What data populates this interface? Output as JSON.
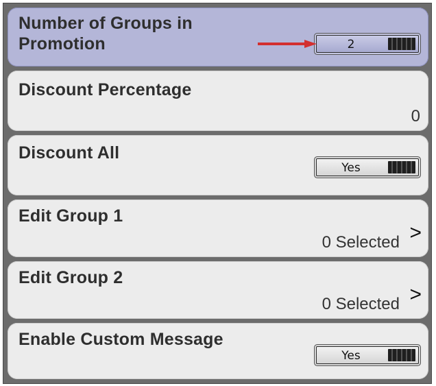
{
  "rows": [
    {
      "label": "Number of Groups in\nPromotion",
      "control": "toggle",
      "value": "2"
    },
    {
      "label": "Discount Percentage",
      "control": "value",
      "value": "0"
    },
    {
      "label": "Discount All",
      "control": "toggle",
      "value": "Yes"
    },
    {
      "label": "Edit Group 1",
      "control": "link",
      "value": "0 Selected",
      "chevron": ">"
    },
    {
      "label": "Edit Group 2",
      "control": "link",
      "value": "0 Selected",
      "chevron": ">"
    },
    {
      "label": "Enable Custom Message",
      "control": "toggle",
      "value": "Yes"
    }
  ],
  "annotation": {
    "arrow_color": "#d32f2f"
  }
}
